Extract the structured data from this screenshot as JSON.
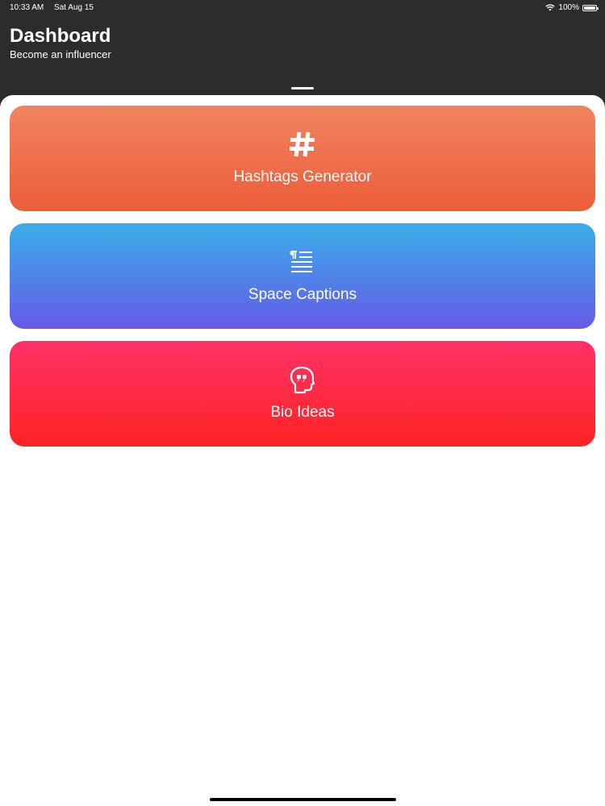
{
  "status_bar": {
    "time": "10:33 AM",
    "date": "Sat Aug 15",
    "battery_percent": "100%",
    "battery_level": 1.0
  },
  "header": {
    "title": "Dashboard",
    "subtitle": "Become an influencer"
  },
  "cards": [
    {
      "label": "Hashtags Generator",
      "icon": "hashtag-icon",
      "colors": [
        "#f08460",
        "#ec5d3a"
      ]
    },
    {
      "label": "Space Captions",
      "icon": "paragraph-lines-icon",
      "colors": [
        "#3aaee8",
        "#655be8"
      ]
    },
    {
      "label": "Bio Ideas",
      "icon": "head-quote-icon",
      "colors": [
        "#fe3169",
        "#fe2421"
      ]
    }
  ],
  "colors": {
    "header_bg": "#2c2c2e",
    "sheet_bg": "#ffffff"
  }
}
